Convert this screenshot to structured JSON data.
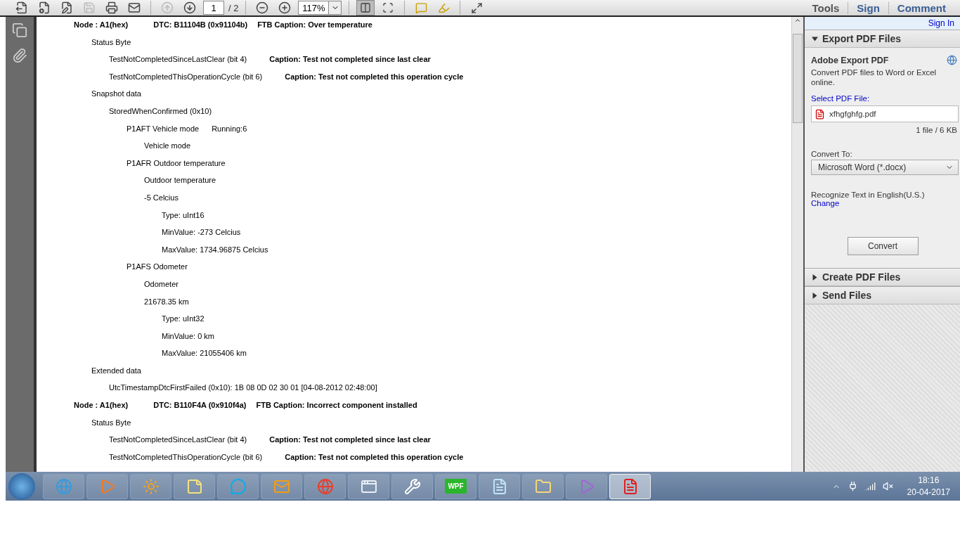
{
  "toolbar": {
    "buttons": [
      {
        "kind": "export",
        "disabled": false
      },
      {
        "kind": "create",
        "disabled": false
      },
      {
        "kind": "edit",
        "disabled": false
      },
      {
        "kind": "save",
        "disabled": true
      },
      {
        "kind": "print",
        "disabled": false
      },
      {
        "kind": "mail",
        "disabled": false
      },
      {
        "kind": "prev",
        "disabled": true
      },
      {
        "kind": "next",
        "disabled": false
      }
    ],
    "page": {
      "value": "1",
      "total": "/ 2"
    },
    "zoom_buttons": [
      {
        "kind": "out"
      },
      {
        "kind": "in"
      }
    ],
    "zoom": "117%",
    "view_buttons": [
      {
        "kind": "fit-width",
        "selected": true
      },
      {
        "kind": "fit-page",
        "selected": false
      }
    ],
    "tool_buttons": [
      {
        "kind": "comment"
      },
      {
        "kind": "highlight"
      },
      {
        "kind": "fullscreen"
      }
    ],
    "tabs": [
      "Tools",
      "Sign",
      "Comment"
    ]
  },
  "document": {
    "lines": [
      {
        "kind": "node",
        "cells": [
          "Node : A1(hex)",
          "DTC: B11104B (0x91104b)",
          "FTB Caption: Over temperature"
        ],
        "children": [
          {
            "kind": "entry",
            "text": "Status Byte",
            "children": [
              {
                "kind": "entry",
                "text": "TestNotCompletedSinceLastClear (bit 4)",
                "note": "Caption: Test not completed since last clear"
              },
              {
                "kind": "entry",
                "text": "TestNotCompletedThisOperationCycle (bit 6)",
                "note": "Caption: Test not completed this operation cycle"
              }
            ]
          },
          {
            "kind": "entry",
            "text": "Snapshot data",
            "children": [
              {
                "kind": "entry",
                "text": "StoredWhenConfirmed (0x10)",
                "children": [
                  {
                    "kind": "entry",
                    "text": "P1AFT Vehicle mode",
                    "note": "Running:6",
                    "children": [
                      {
                        "kind": "entry",
                        "text": "Vehicle mode"
                      }
                    ]
                  },
                  {
                    "kind": "entry",
                    "text": "P1AFR Outdoor temperature",
                    "children": [
                      {
                        "kind": "entry",
                        "text": "Outdoor temperature"
                      },
                      {
                        "kind": "entry",
                        "text": "-5 Celcius",
                        "children": [
                          {
                            "kind": "entry",
                            "text": "Type: uInt16"
                          },
                          {
                            "kind": "entry",
                            "text": "MinValue: -273 Celcius"
                          },
                          {
                            "kind": "entry",
                            "text": "MaxValue: 1734.96875 Celcius"
                          }
                        ]
                      }
                    ]
                  },
                  {
                    "kind": "entry",
                    "text": "P1AFS Odometer",
                    "children": [
                      {
                        "kind": "entry",
                        "text": "Odometer"
                      },
                      {
                        "kind": "entry",
                        "text": "21678.35 km",
                        "children": [
                          {
                            "kind": "entry",
                            "text": "Type: uInt32"
                          },
                          {
                            "kind": "entry",
                            "text": "MinValue: 0 km"
                          },
                          {
                            "kind": "entry",
                            "text": "MaxValue: 21055406 km"
                          }
                        ]
                      }
                    ]
                  }
                ]
              }
            ]
          },
          {
            "kind": "entry",
            "text": "Extended data",
            "children": [
              {
                "kind": "entry",
                "text": "UtcTimestampDtcFirstFailed (0x10): 1B 08 0D 02 30 01 [04-08-2012 02:48:00]"
              }
            ]
          }
        ]
      },
      {
        "kind": "node",
        "cells": [
          "Node : A1(hex)",
          "DTC: B110F4A (0x910f4a)",
          "FTB Caption: Incorrect component installed"
        ],
        "children": [
          {
            "kind": "entry",
            "text": "Status Byte",
            "children": [
              {
                "kind": "entry",
                "text": "TestNotCompletedSinceLastClear (bit 4)",
                "note": "Caption: Test not completed since last clear"
              },
              {
                "kind": "entry",
                "text": "TestNotCompletedThisOperationCycle (bit 6)",
                "note": "Caption: Test not completed this operation cycle"
              }
            ]
          }
        ]
      }
    ]
  },
  "panel": {
    "sign_in": "Sign In",
    "sections": [
      {
        "title": "Export PDF Files",
        "expanded": true
      },
      {
        "title": "Create PDF Files",
        "expanded": false
      },
      {
        "title": "Send Files",
        "expanded": false
      }
    ],
    "export": {
      "title": "Adobe Export PDF",
      "description": "Convert PDF files to Word or Excel online.",
      "select_label": "Select PDF File:",
      "file": "xfhgfghfg.pdf",
      "file_info": "1 file / 6 KB",
      "convert_label": "Convert To:",
      "format": "Microsoft Word (*.docx)",
      "recognize": "Recognize Text in English(U.S.)",
      "change": "Change",
      "button": "Convert"
    }
  },
  "taskbar": {
    "apps": [
      {
        "kind": "browser",
        "selected": false
      },
      {
        "kind": "media",
        "selected": false
      },
      {
        "kind": "photo",
        "selected": false
      },
      {
        "kind": "notes",
        "selected": false
      },
      {
        "kind": "chat",
        "selected": false
      },
      {
        "kind": "mail",
        "selected": false
      },
      {
        "kind": "globe",
        "selected": false
      },
      {
        "kind": "window",
        "selected": false
      },
      {
        "kind": "tool",
        "selected": false
      },
      {
        "kind": "badge",
        "label": "WPF",
        "selected": false
      },
      {
        "kind": "notepad",
        "selected": false
      },
      {
        "kind": "folder",
        "selected": false
      },
      {
        "kind": "studio",
        "selected": false
      },
      {
        "kind": "reader",
        "selected": true
      }
    ],
    "time": "18:16",
    "date": "20-04-2017"
  }
}
